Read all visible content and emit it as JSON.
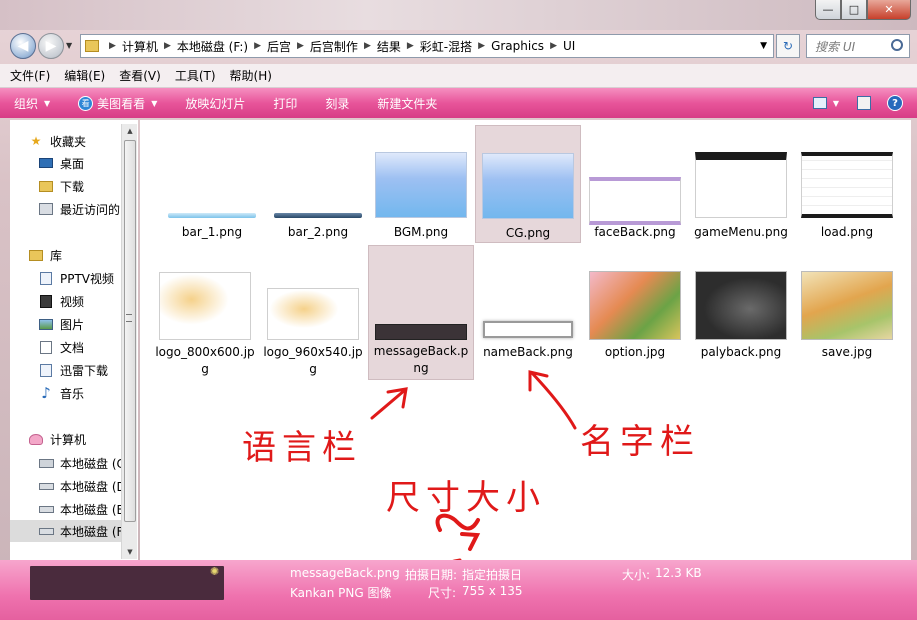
{
  "window": {
    "min_glyph": "—",
    "max_glyph": "□",
    "close_glyph": "✕"
  },
  "address": {
    "crumbs": [
      "计算机",
      "本地磁盘 (F:)",
      "后宫",
      "后宫制作",
      "结果",
      "彩虹-混搭",
      "Graphics",
      "UI"
    ],
    "search_placeholder": "搜索 UI"
  },
  "menu": [
    "文件(F)",
    "编辑(E)",
    "查看(V)",
    "工具(T)",
    "帮助(H)"
  ],
  "toolbar": {
    "organize": "组织",
    "meitu": "美图看看",
    "slideshow": "放映幻灯片",
    "print": "打印",
    "burn": "刻录",
    "new_folder": "新建文件夹"
  },
  "nav": {
    "favorites": "收藏夹",
    "desktop": "桌面",
    "downloads": "下载",
    "recent": "最近访问的",
    "libraries": "库",
    "pptv": "PPTV视频",
    "video": "视频",
    "pictures": "图片",
    "documents": "文档",
    "xunlei": "迅雷下载",
    "music": "音乐",
    "computer": "计算机",
    "drive_c": "本地磁盘 (C",
    "drive_d": "本地磁盘 (D",
    "drive_e": "本地磁盘 (E",
    "drive_f": "本地磁盘 (F"
  },
  "files": [
    {
      "name": "bar_1.png"
    },
    {
      "name": "bar_2.png"
    },
    {
      "name": "BGM.png"
    },
    {
      "name": "CG.png"
    },
    {
      "name": "faceBack.png"
    },
    {
      "name": "gameMenu.png"
    },
    {
      "name": "load.png"
    },
    {
      "name": "logo_800x600.jpg"
    },
    {
      "name": "logo_960x540.jpg"
    },
    {
      "name": "messageBack.png"
    },
    {
      "name": "nameBack.png"
    },
    {
      "name": "option.jpg"
    },
    {
      "name": "palyback.png"
    },
    {
      "name": "save.jpg"
    }
  ],
  "details": {
    "filename": "messageBack.png",
    "taken_label": "拍摄日期:",
    "taken_value": "指定拍摄日",
    "type": "Kankan PNG 图像",
    "size_label": "大小:",
    "size_value": "12.3 KB",
    "dims_label": "尺寸:",
    "dims_value": "755 x 135"
  },
  "annotations": {
    "language_bar": "语言栏",
    "name_bar": "名字栏",
    "dimensions": "尺寸大小"
  },
  "colors": {
    "toolbar_pink": "#e8559a",
    "details_pink": "#ef72ae",
    "annotation_red": "#e01919",
    "selection": "#e6d7da"
  }
}
